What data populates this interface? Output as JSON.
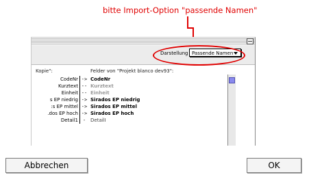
{
  "annotation": {
    "text": "bitte Import-Option \"passende Namen\""
  },
  "window": {
    "view_label": "Darstellung",
    "view_value": "Passende Namen",
    "source_header": "Kopie\":",
    "target_header": "Felder von \"Projekt blanco dev93\":"
  },
  "rows": [
    {
      "src": "CodeNr",
      "arrow": "->",
      "dst": "CodeNr"
    },
    {
      "src": "Kurztext",
      "arrow": "--",
      "dst": "Kurztext"
    },
    {
      "src": "Einheit",
      "arrow": "--",
      "dst": "Einheit"
    },
    {
      "src": "s EP niedrig",
      "arrow": "->",
      "dst": "Sirados EP niedrig"
    },
    {
      "src": ":s EP mittel",
      "arrow": "->",
      "dst": "Sirados EP mittel"
    },
    {
      "src": ".dos EP hoch",
      "arrow": "->",
      "dst": "Sirados EP hoch"
    },
    {
      "src": "Detail1",
      "arrow": "-",
      "dst": "DetailI"
    }
  ],
  "buttons": {
    "cancel": "Abbrechen",
    "ok": "OK"
  },
  "colors": {
    "annotation_red": "#e00000",
    "scroll_thumb": "#8a8aee"
  }
}
